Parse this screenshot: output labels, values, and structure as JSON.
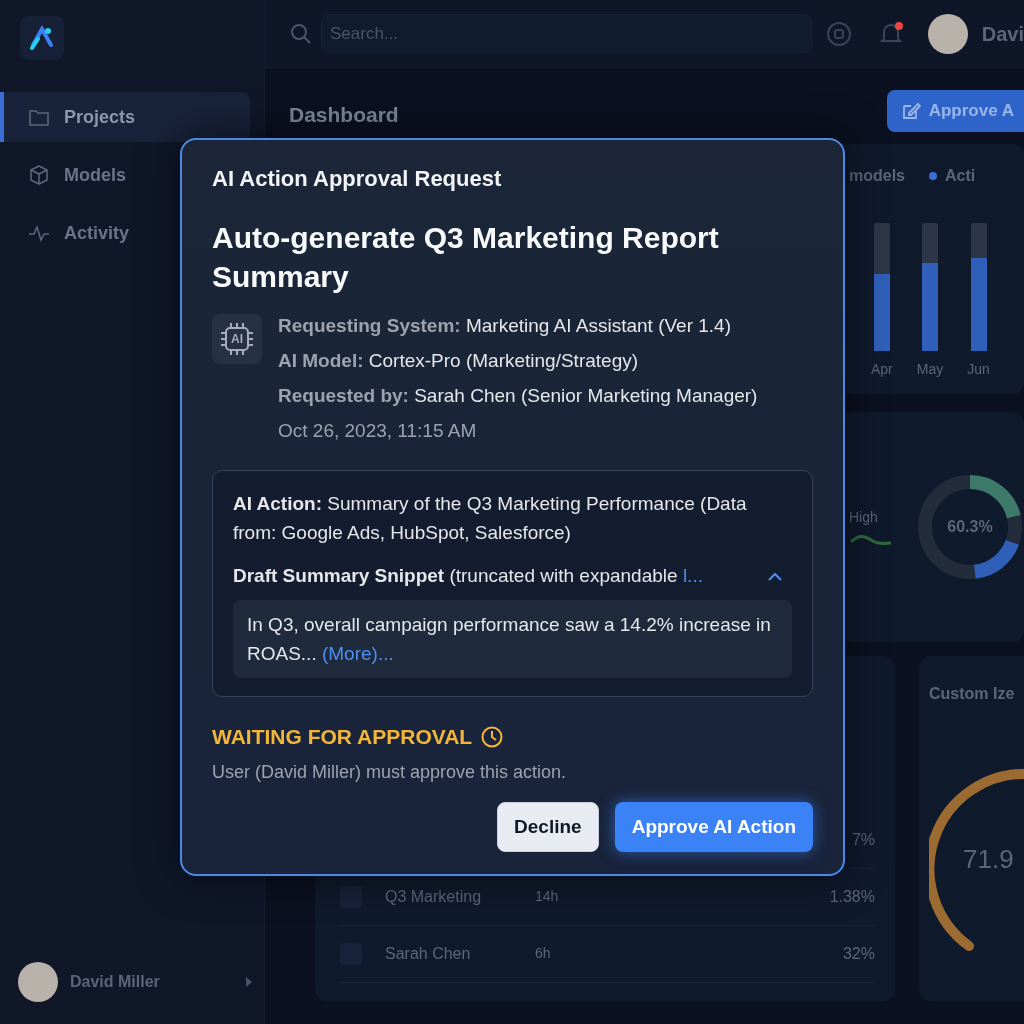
{
  "sidebar": {
    "items": [
      {
        "label": "Projects",
        "selected": true
      },
      {
        "label": "Models",
        "selected": false
      },
      {
        "label": "Activity",
        "selected": false
      }
    ],
    "user_name": "David Miller"
  },
  "topbar": {
    "search": {
      "placeholder": "Search..."
    },
    "notification_unread": true,
    "user_name": "Davi"
  },
  "dashboard": {
    "title": "Dashboard",
    "action_button": "Approve A",
    "chart_card": {
      "legend": [
        "models",
        "Acti"
      ],
      "bars": [
        {
          "label": "Apr",
          "level": 0.6
        },
        {
          "label": "May",
          "level": 0.68
        },
        {
          "label": "Jun",
          "level": 0.72
        }
      ]
    },
    "mix_card": {
      "legend": "High",
      "donut_value": "60.3%"
    },
    "table_card": {
      "rows": [
        {
          "value": "7%"
        },
        {
          "name": "Q3 Marketing",
          "time": "14h",
          "value": "1.38%"
        },
        {
          "name": "Sarah Chen",
          "time": "6h",
          "value": "32%"
        }
      ]
    },
    "gauge_card": {
      "title": "Custom Ize",
      "value": "71.9"
    }
  },
  "modal": {
    "chip_label": "AI",
    "header": "AI Action Approval Request",
    "title": "Auto-generate Q3 Marketing Report Summary",
    "details": [
      {
        "label": "Requesting System:",
        "value": "Marketing AI Assistant (Ver 1.4)"
      },
      {
        "label": "AI Model:",
        "value": "Cortex-Pro (Marketing/Strategy)"
      },
      {
        "label": "Requested by:",
        "value": "Sarah Chen (Senior Marketing Manager)"
      }
    ],
    "timestamp": "Oct 26, 2023, 11:15 AM",
    "action": {
      "label": "AI Action:",
      "text": "Summary of the Q3 Marketing Performance (Data from: Google Ads, HubSpot, Salesforce)"
    },
    "snippet": {
      "label": "Draft Summary Snippet",
      "note": "(truncated with expandable ",
      "link": "l...",
      "expanded": true,
      "text": "In Q3, overall campaign performance saw a 14.2% increase in ROAS... ",
      "more": "(More)..."
    },
    "status": {
      "label": "WAITING FOR APPROVAL",
      "message": "User (David Miller) must approve this action."
    },
    "buttons": [
      {
        "label": "Decline",
        "kind": "secondary"
      },
      {
        "label": "Approve AI Action",
        "kind": "primary"
      }
    ]
  }
}
